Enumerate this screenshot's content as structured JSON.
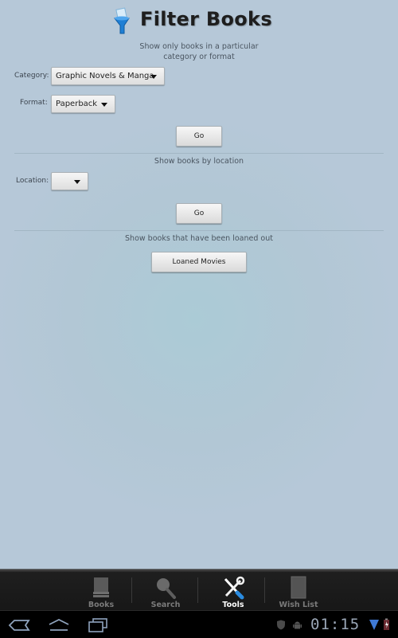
{
  "header": {
    "title": "Filter Books",
    "logo_icon": "funnel-filter-icon"
  },
  "category_section": {
    "description": "Show only books in a particular category or format",
    "description_line1": "Show only books in a particular",
    "description_line2": "category or format",
    "category_label": "Category:",
    "category_value": "Graphic Novels & Manga",
    "format_label": "Format:",
    "format_value": "Paperback",
    "go_label": "Go"
  },
  "location_section": {
    "description": "Show books by location",
    "location_label": "Location:",
    "location_value": "",
    "go_label": "Go"
  },
  "loaned_section": {
    "description": "Show books that have been loaned out",
    "button_label": "Loaned Movies"
  },
  "tabbar": {
    "active": "Tools",
    "tabs": [
      {
        "label": "Books",
        "icon": "books-stack-icon"
      },
      {
        "label": "Search",
        "icon": "magnifier-icon"
      },
      {
        "label": "Tools",
        "icon": "wrench-screwdriver-icon"
      },
      {
        "label": "Wish List",
        "icon": "wishlist-book-icon"
      }
    ]
  },
  "system_bar": {
    "time": "01:15",
    "nav_buttons": [
      "back",
      "home",
      "recent-apps"
    ],
    "status_icons": [
      "shield-icon",
      "android-debug-icon",
      "wifi-signal-icon",
      "battery-charging-icon"
    ]
  }
}
